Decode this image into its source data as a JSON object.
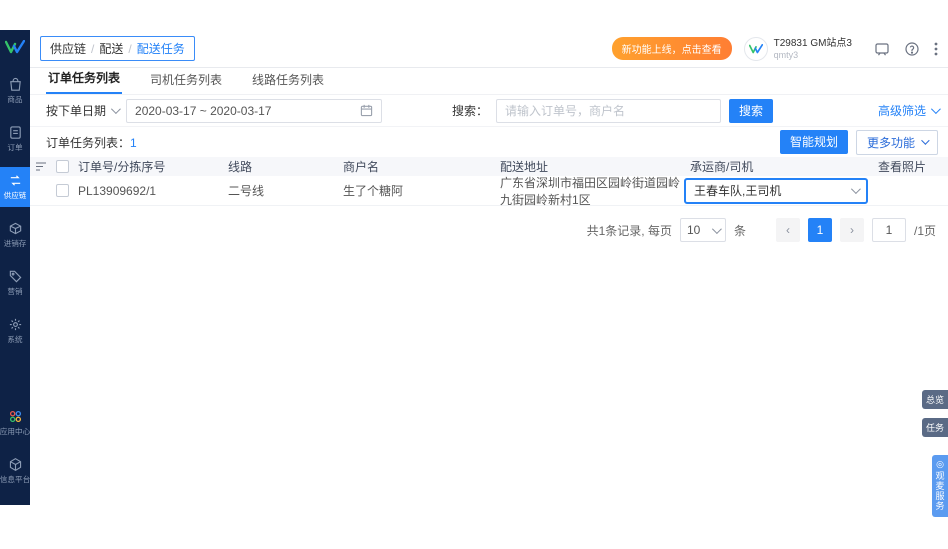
{
  "sidebar": {
    "items": [
      {
        "icon": "bag-icon",
        "label": "商品",
        "active": false
      },
      {
        "icon": "document-icon",
        "label": "订单",
        "active": false
      },
      {
        "icon": "exchange-icon",
        "label": "供应链",
        "active": true
      },
      {
        "icon": "box-icon",
        "label": "进销存",
        "active": false
      },
      {
        "icon": "tag-icon",
        "label": "营销",
        "active": false
      },
      {
        "icon": "gear-icon",
        "label": "系统",
        "active": false
      },
      {
        "icon": "apps-icon",
        "label": "应用中心",
        "active": false
      },
      {
        "icon": "hexagon-icon",
        "label": "信息平台",
        "active": false
      }
    ]
  },
  "header": {
    "breadcrumb": {
      "0": "供应链",
      "1": "配送",
      "2": "配送任务",
      "separator": "/"
    },
    "promo_badge": "新功能上线，点击查看",
    "user_name": "T29831 GM站点3",
    "user_sub": "qmty3"
  },
  "tabs": {
    "0": "订单任务列表",
    "1": "司机任务列表",
    "2": "线路任务列表"
  },
  "filters": {
    "date_type_label": "按下单日期",
    "date_range": "2020-03-17 ~ 2020-03-17",
    "search_label": "搜索：",
    "search_placeholder": "请输入订单号，商户名",
    "search_button": "搜索",
    "advanced_filter": "高级筛选"
  },
  "toolbar": {
    "list_label": "订单任务列表：",
    "list_count": "1",
    "smart_plan_button": "智能规划",
    "more_button": "更多功能"
  },
  "table": {
    "headers": {
      "order": "订单号/分拣序号",
      "route": "线路",
      "merchant": "商户名",
      "address": "配送地址",
      "carrier": "承运商/司机",
      "photo": "查看照片"
    },
    "row": {
      "order_no": "PL13909692/1",
      "route": "二号线",
      "merchant": "生了个糖阿",
      "address": "广东省深圳市福田区园岭街道园岭九街园岭新村1区",
      "carrier_selected": "王春车队,王司机"
    }
  },
  "pagination": {
    "total_text": "共1条记录, 每页",
    "page_size": "10",
    "unit": "条",
    "prev": "‹",
    "current_page": "1",
    "next": "›",
    "jump_value": "1",
    "total_pages": "/1页"
  },
  "floating_tags": {
    "overview": "总览",
    "task": "任务",
    "service": "观麦服务"
  },
  "colors": {
    "primary": "#2482f7",
    "sidebar_bg": "#0e2246",
    "promo_orange": "#ff8f30"
  }
}
